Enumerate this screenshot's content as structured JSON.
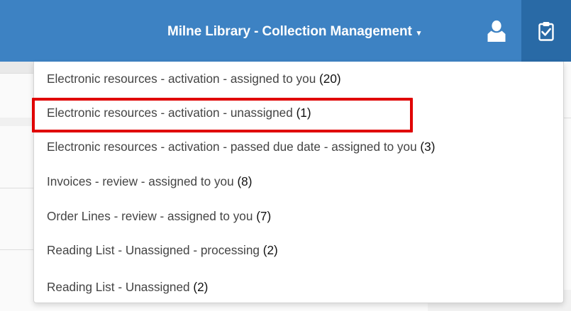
{
  "header": {
    "library_label": "Milne Library - Collection Management",
    "caret": "▾",
    "user_icon": "user-icon",
    "tasks_icon": "tasks-clipboard-check-icon",
    "bar_color": "#3d82c3",
    "tasks_bg_color": "#296aa6"
  },
  "tasks_menu": {
    "items": [
      {
        "label": "Electronic resources - activation - assigned to you",
        "count": "(20)"
      },
      {
        "label": "Electronic resources - activation - unassigned",
        "count": "(1)"
      },
      {
        "label": "Electronic resources - activation - passed due date - assigned to you",
        "count": "(3)"
      },
      {
        "label": "Invoices - review - assigned to you",
        "count": "(8)"
      },
      {
        "label": "Order Lines - review - assigned to you",
        "count": "(7)"
      },
      {
        "label": "Reading List - Unassigned - processing",
        "count": "(2)"
      },
      {
        "label": "Reading List - Unassigned",
        "count": "(2)"
      }
    ],
    "highlighted_item_index": 1,
    "highlight_color": "#e00000"
  }
}
